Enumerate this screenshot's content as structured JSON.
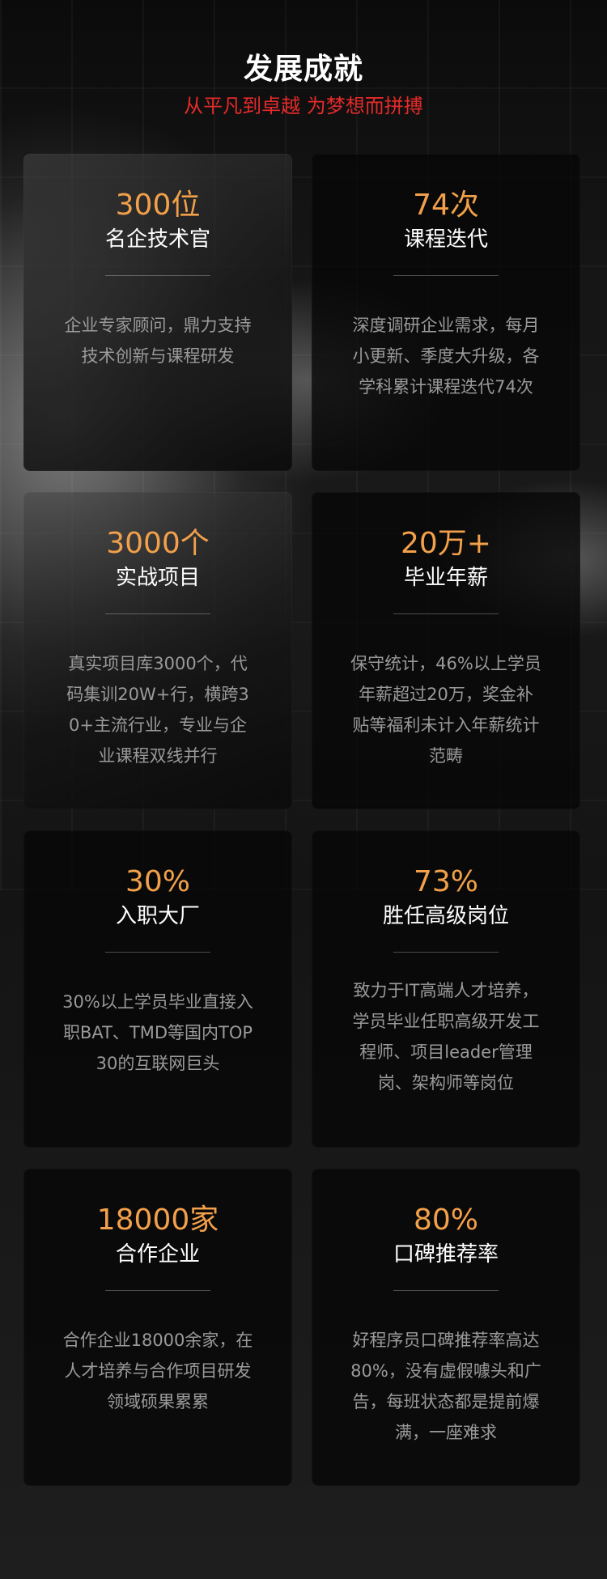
{
  "header": {
    "title": "发展成就",
    "subtitle": "从平凡到卓越 为梦想而拼搏"
  },
  "cards": [
    {
      "stat": "300位",
      "label": "名企技术官",
      "desc": "企业专家顾问，鼎力支持技术创新与课程研发"
    },
    {
      "stat": "74次",
      "label": "课程迭代",
      "desc": "深度调研企业需求，每月小更新、季度大升级，各学科累计课程迭代74次"
    },
    {
      "stat": "3000个",
      "label": "实战项目",
      "desc": "真实项目库3000个，代码集训20W+行，横跨30+主流行业，专业与企业课程双线并行"
    },
    {
      "stat": "20万+",
      "label": "毕业年薪",
      "desc": "保守统计，46%以上学员年薪超过20万，奖金补贴等福利未计入年薪统计范畴"
    },
    {
      "stat": "30%",
      "label": "入职大厂",
      "desc": "30%以上学员毕业直接入职BAT、TMD等国内TOP30的互联网巨头"
    },
    {
      "stat": "73%",
      "label": "胜任高级岗位",
      "desc": "致力于IT高端人才培养，学员毕业任职高级开发工程师、项目leader管理岗、架构师等岗位"
    },
    {
      "stat": "18000家",
      "label": "合作企业",
      "desc": "合作企业18000余家，在人才培养与合作项目研发领域硕果累累"
    },
    {
      "stat": "80%",
      "label": "口碑推荐率",
      "desc": "好程序员口碑推荐率高达80%，没有虚假噱头和广告，每班状态都是提前爆满，一座难求"
    }
  ],
  "colors": {
    "background": "#1c1c1c",
    "card": "#060606",
    "stat_accent": "#f3a04a",
    "subtitle_red": "#e62a2a",
    "desc_gray": "#9a9a9a"
  }
}
